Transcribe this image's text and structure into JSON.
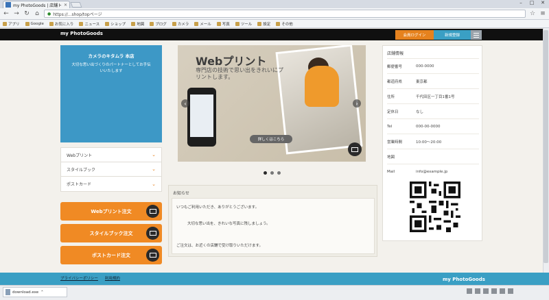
{
  "browser": {
    "tab_title": "my PhotoGoods | 店舗トップ",
    "url": "https://...shop/topページ",
    "bookmarks": [
      "アプリ",
      "Google",
      "お気に入り",
      "ニュース",
      "ショップ",
      "地図",
      "ブログ",
      "カメラ",
      "メール",
      "写真",
      "ツール",
      "設定",
      "その他"
    ]
  },
  "site": {
    "logo": "my PhotoGoods",
    "login_label": "会員ログイン",
    "register_label": "新規登録"
  },
  "store": {
    "name": "カメラのキタムラ 本店",
    "catchcopy": "大切な思い出づくりのパートナーとしてお手伝いいたします"
  },
  "leftnav": {
    "items": [
      "Webプリント",
      "スタイルブック",
      "ポストカード"
    ]
  },
  "order_buttons": [
    "Webプリント注文",
    "スタイルブック注文",
    "ポストカード注文"
  ],
  "banner": {
    "title": "Webプリント",
    "subtitle": "専門店の技術で思い出をきれいにプリントします。",
    "detail_label": "詳しくはこちら"
  },
  "news": {
    "title": "お知らせ",
    "lines": [
      "いつもご利用いただき、ありがとうございます。",
      "大切な思い出を、きれいな写真に残しましょう。",
      "ご注文は、お近くの店舗で受け取りいただけます。"
    ]
  },
  "storeinfo": {
    "title": "店舗情報",
    "rows": [
      {
        "label": "郵便番号",
        "value": "000-0000"
      },
      {
        "label": "都道府県",
        "value": "東京都"
      },
      {
        "label": "住所",
        "value": "千代田区一丁目1番1号"
      },
      {
        "label": "定休日",
        "value": "なし"
      },
      {
        "label": "Tel",
        "value": "000-00-0000"
      },
      {
        "label": "営業時間",
        "value": "10:00〜20:00"
      },
      {
        "label": "地図",
        "value": ""
      },
      {
        "label": "Mail",
        "value": "info@example.jp"
      }
    ]
  },
  "footer": {
    "links": [
      "プライバシーポリシー",
      "利用規約"
    ],
    "logo": "my PhotoGoods"
  },
  "download": {
    "file": "download.exe"
  },
  "colors": {
    "accent_orange": "#f08a24",
    "accent_blue": "#3a9fc4",
    "header_black": "#101010"
  }
}
